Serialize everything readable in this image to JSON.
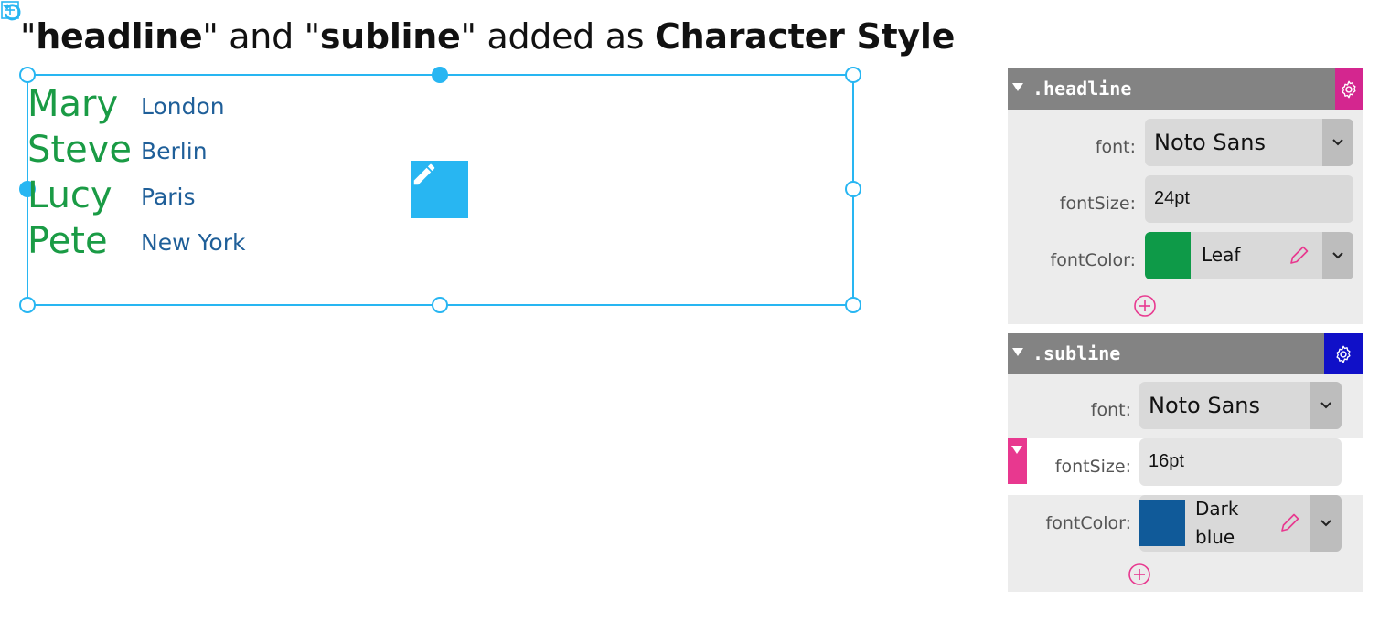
{
  "title": {
    "q1": "\"",
    "headline": "headline",
    "mid": "\" and \"",
    "subline": "subline",
    "mid2": "\" added as ",
    "style_type": "Character Style"
  },
  "canvas": {
    "names": [
      "Mary",
      "Steve",
      "Lucy",
      "Pete"
    ],
    "cities": [
      "London",
      "Berlin",
      "Paris",
      "New York"
    ],
    "headline_color": "#1a9b45",
    "subline_color": "#1f5f99",
    "selection_color": "#28b6f2",
    "icons": [
      "pencil-icon",
      "rotate-icon",
      "add-frame-icon"
    ]
  },
  "panels": [
    {
      "class_name": ".headline",
      "gear_color": "#d4268f",
      "font_label": "font:",
      "font_value": "Noto Sans",
      "size_label": "fontSize:",
      "size_value": "24pt",
      "color_label": "fontColor:",
      "color_name": "Leaf",
      "color_hex": "#0e9a48"
    },
    {
      "class_name": ".subline",
      "gear_color": "#1010c8",
      "font_label": "font:",
      "font_value": "Noto Sans",
      "size_label": "fontSize:",
      "size_value": "16pt",
      "color_label": "fontColor:",
      "color_name_line1": "Dark",
      "color_name_line2": "blue",
      "color_hex": "#105a99"
    }
  ],
  "accent_color": "#e8388f"
}
